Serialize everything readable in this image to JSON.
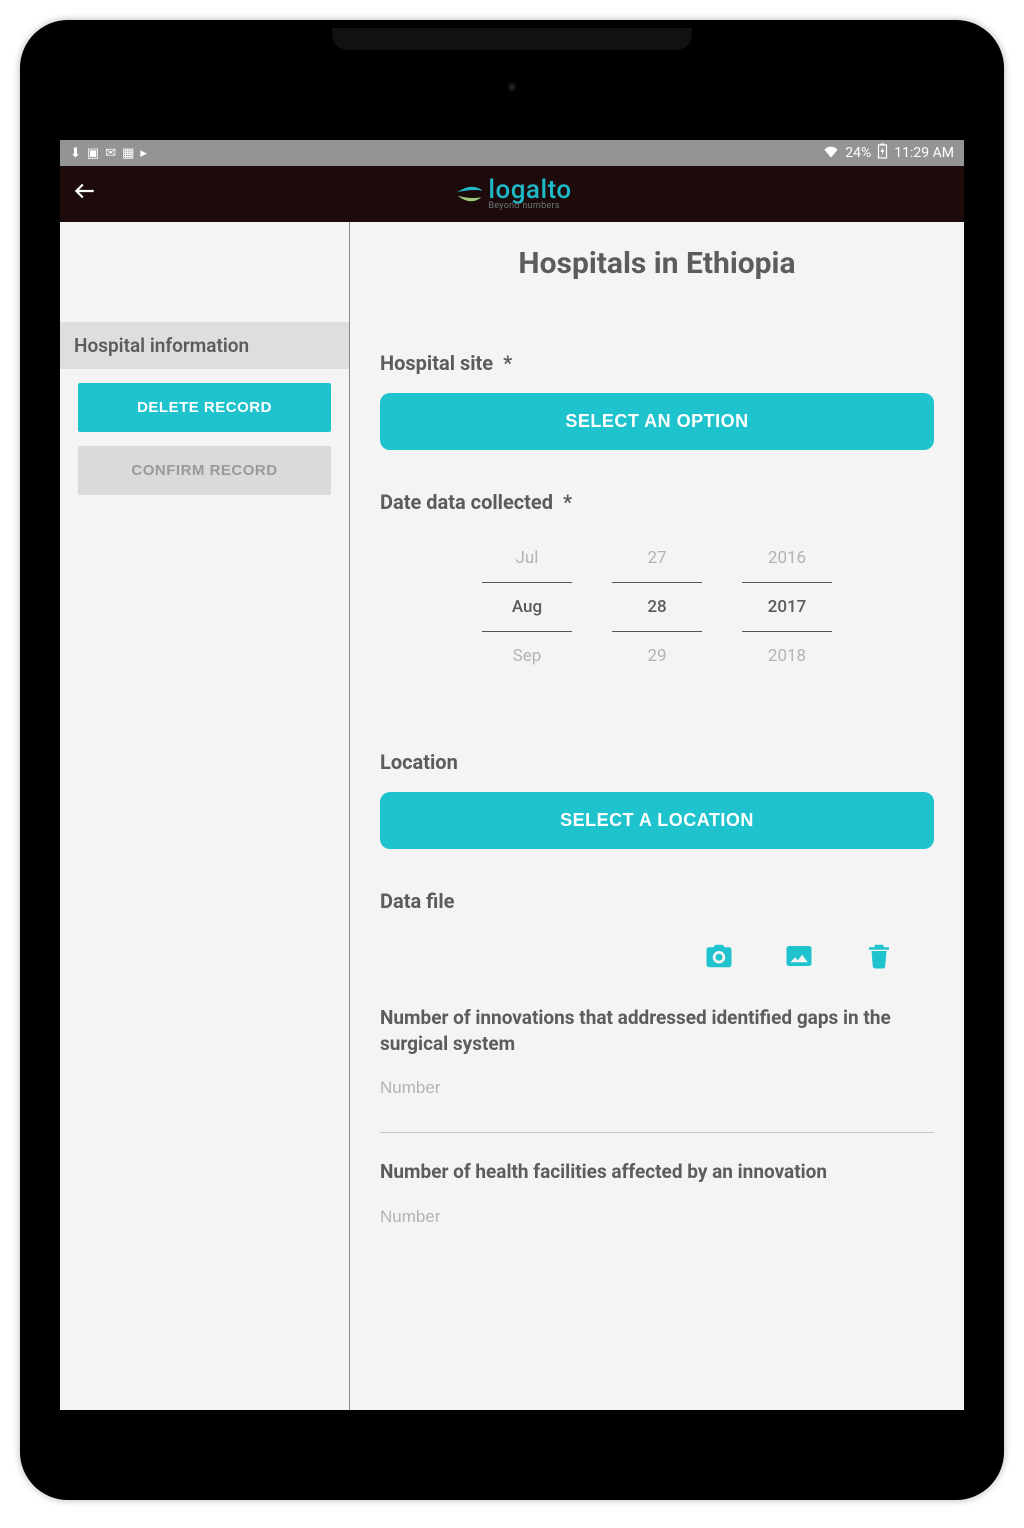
{
  "status": {
    "battery": "24%",
    "time": "11:29 AM"
  },
  "logo": {
    "name": "logalto",
    "tagline": "Beyond numbers"
  },
  "sidebar": {
    "section_title": "Hospital information",
    "delete_label": "DELETE RECORD",
    "confirm_label": "CONFIRM RECORD"
  },
  "main": {
    "title": "Hospitals in Ethiopia",
    "hospital_site_label": "Hospital site",
    "hospital_site_req": "*",
    "select_option_label": "SELECT AN OPTION",
    "date_label": "Date data collected",
    "date_req": "*",
    "date": {
      "month_prev": "Jul",
      "month_sel": "Aug",
      "month_next": "Sep",
      "day_prev": "27",
      "day_sel": "28",
      "day_next": "29",
      "year_prev": "2016",
      "year_sel": "2017",
      "year_next": "2018"
    },
    "location_label": "Location",
    "select_location_label": "SELECT A LOCATION",
    "data_file_label": "Data file",
    "q1_label": "Number of innovations that addressed identified gaps in the surgical system",
    "q1_placeholder": "Number",
    "q2_label": "Number of health facilities affected by an innovation",
    "q2_placeholder": "Number"
  }
}
